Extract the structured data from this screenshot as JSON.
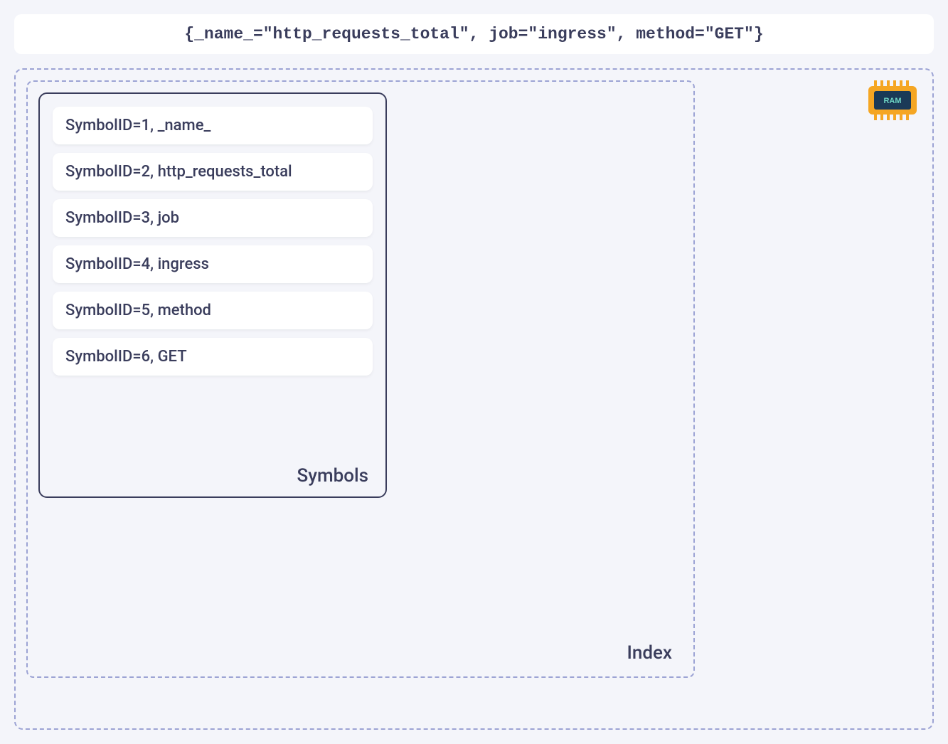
{
  "query": "{_name_=\"http_requests_total\", job=\"ingress\", method=\"GET\"}",
  "outerLabel": "",
  "indexLabel": "Index",
  "symbolsLabel": "Symbols",
  "ramLabel": "RAM",
  "symbols": {
    "item0": "SymbolID=1, _name_",
    "item1": "SymbolID=2, http_requests_total",
    "item2": "SymbolID=3, job",
    "item3": "SymbolID=4, ingress",
    "item4": "SymbolID=5, method",
    "item5": "SymbolID=6, GET"
  },
  "colors": {
    "background": "#f4f5fa",
    "border": "#9ca3d4",
    "text": "#3a3d5c",
    "ramOuter": "#f5a623",
    "ramInner": "#1b3a57"
  }
}
